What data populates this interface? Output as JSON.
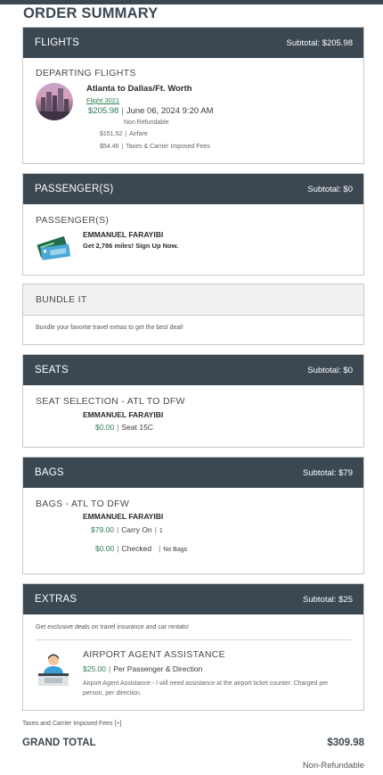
{
  "page": {
    "title": "ORDER SUMMARY"
  },
  "flights": {
    "header": "FLIGHTS",
    "subtotal": "Subtotal: $205.98",
    "section_label": "DEPARTING FLIGHTS",
    "route": "Atlanta to Dallas/Ft. Worth",
    "flight_link": "Flight 3021",
    "price": "$205.98",
    "date": "June 06, 2024 9:20 AM",
    "refund": "Non Refundable",
    "airfare_amount": "$151.52",
    "airfare_label": "Airfare",
    "taxes_amount": "$54.46",
    "taxes_label": "Taxes & Carrier Imposed Fees"
  },
  "passengers": {
    "header": "PASSENGER(S)",
    "subtotal": "Subtotal: $0",
    "section_label": "PASSENGER(S)",
    "name": "EMMANUEL FARAYIBI",
    "miles_promo": "Get 2,786 miles! Sign Up Now."
  },
  "bundle": {
    "header": "BUNDLE IT",
    "text": "Bundle your favorite travel extras to get the best deal!"
  },
  "seats": {
    "header": "SEATS",
    "subtotal": "Subtotal: $0",
    "section_label": "SEAT SELECTION - ATL TO DFW",
    "name": "EMMANUEL FARAYIBI",
    "price": "$0.00",
    "seat": "Seat 15C"
  },
  "bags": {
    "header": "BAGS",
    "subtotal": "Subtotal: $79",
    "section_label": "BAGS - ATL TO DFW",
    "name": "EMMANUEL FARAYIBI",
    "carry_price": "$79.00",
    "carry_label": "Carry On",
    "carry_count": "1",
    "checked_price": "$0.00",
    "checked_label": "Checked",
    "checked_count": "No Bags"
  },
  "extras": {
    "header": "EXTRAS",
    "subtotal": "Subtotal: $25",
    "deals_text": "Get exclusive deals on travel insurance and car rentals!",
    "item_title": "AIRPORT AGENT ASSISTANCE",
    "item_price": "$25.00",
    "item_unit": "Per Passenger & Direction",
    "item_desc": "Airport Agent Assistance - I will need assistance at the airport ticket counter. Charged per person, per direction."
  },
  "footer": {
    "taxes_link": "Taxes and Carrier Imposed Fees [+]",
    "grand_total_label": "GRAND TOTAL",
    "grand_total": "$309.98",
    "refund": "Non-Refundable"
  },
  "colors": {
    "header_bg": "#3b4852",
    "accent_green": "#2e7d4f",
    "border": "#c9c9c9"
  }
}
